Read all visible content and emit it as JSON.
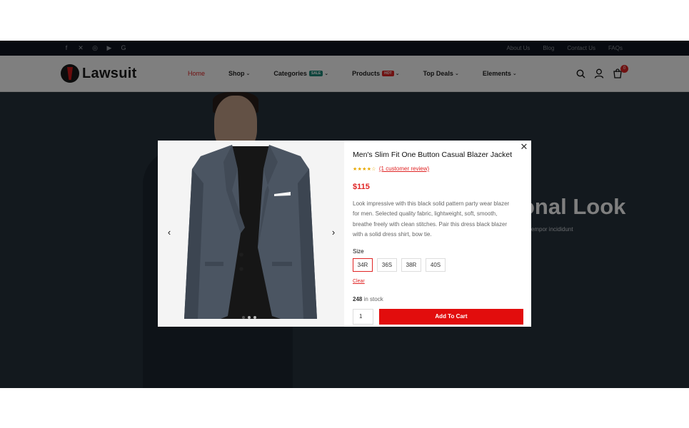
{
  "topbar": {
    "social_icons": [
      "facebook-icon",
      "x-icon",
      "instagram-icon",
      "youtube-icon",
      "google-icon"
    ],
    "links": [
      "About Us",
      "Blog",
      "Contact Us",
      "FAQs"
    ]
  },
  "header": {
    "logo_text": "Lawsuit",
    "nav": [
      {
        "label": "Home",
        "active": true
      },
      {
        "label": "Shop"
      },
      {
        "label": "Categories",
        "badge": "SALE",
        "badge_color": "#1e8a7a"
      },
      {
        "label": "Products",
        "badge": "HOT",
        "badge_color": "#e02424"
      },
      {
        "label": "Top Deals"
      },
      {
        "label": "Elements"
      }
    ],
    "cart_count": "0"
  },
  "hero": {
    "heading": "onal Look",
    "subtext": "d tempor incididunt"
  },
  "modal": {
    "product_title": "Men's Slim Fit One Button Casual Blazer Jacket",
    "rating_stars": 4,
    "review_link": "(1 customer review)",
    "price": "$115",
    "description": "Look impressive with this black solid pattern party wear blazer for men. Selected quality fabric, lightweight, soft, smooth, breathe freely with clean stitches. Pair this dress black blazer with a solid dress shirt, bow tie.",
    "size_label": "Size",
    "sizes": [
      "34R",
      "36S",
      "38R",
      "40S"
    ],
    "selected_size": "34R",
    "clear_label": "Clear",
    "stock_count": "248",
    "stock_suffix": "in stock",
    "quantity": "1",
    "add_to_cart_label": "Add To Cart",
    "gallery_dots": 3,
    "active_dot": 0
  },
  "colors": {
    "accent": "#e02424",
    "add_to_cart": "#e20d0d",
    "topbar": "#0f1520"
  }
}
